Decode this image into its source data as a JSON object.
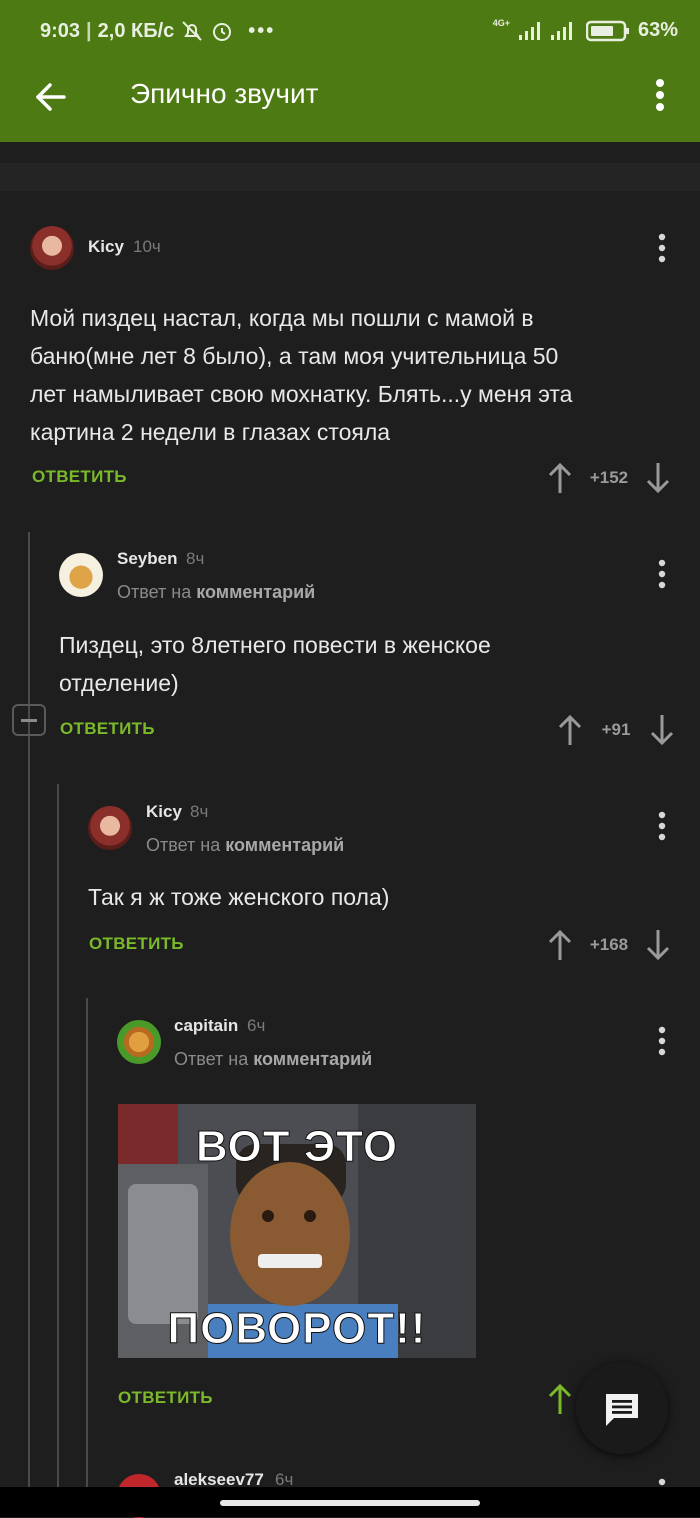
{
  "status_bar": {
    "time": "9:03",
    "speed": "2,0 КБ/с",
    "network": "4G+",
    "battery": "63%"
  },
  "app_bar": {
    "title": "Эпично звучит"
  },
  "reply_prefix": "Ответ на",
  "reply_target": "комментарий",
  "comments": [
    {
      "user": "Kicy",
      "time": "10ч",
      "text_lines": [
        "Мой пиздец настал, когда мы пошли с мамой в",
        "баню(мне лет 8 было), а там моя учительница 50",
        "лет намыливает свою мохнатку. Блять...у меня эта",
        "картина 2 недели в глазах стояла"
      ],
      "reply_label": "ОТВЕТИТЬ",
      "rating": "+152"
    },
    {
      "user": "Seyben",
      "time": "8ч",
      "text_lines": [
        "Пиздец, это 8летнего повести в женское",
        "отделение)"
      ],
      "reply_label": "ОТВЕТИТЬ",
      "rating": "+91"
    },
    {
      "user": "Kicy",
      "time": "8ч",
      "text_lines": [
        "Так я ж тоже женского пола)"
      ],
      "reply_label": "ОТВЕТИТЬ",
      "rating": "+168"
    },
    {
      "user": "capitain",
      "time": "6ч",
      "meme_top": "ВОТ ЭТО",
      "meme_bottom": "ПОВОРОТ!!",
      "reply_label": "ОТВЕТИТЬ"
    },
    {
      "user": "alekseev77",
      "time": "6ч"
    }
  ],
  "colors": {
    "accent": "#7ab929",
    "toolbar": "#4d7a12",
    "background": "#1e1e1e"
  }
}
